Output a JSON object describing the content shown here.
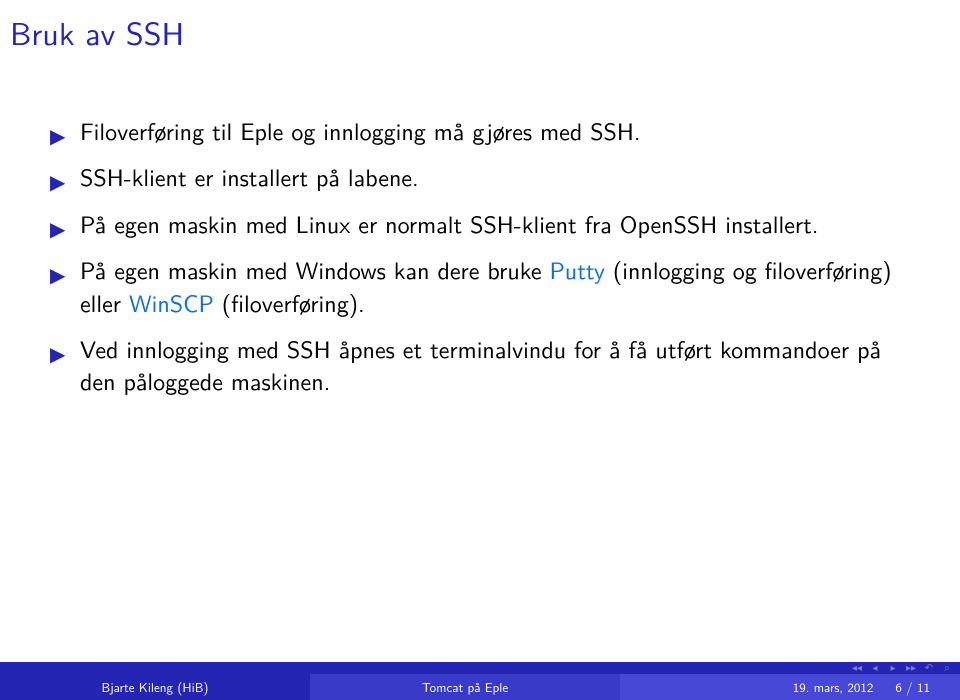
{
  "title": "Bruk av SSH",
  "bullets": [
    {
      "segments": [
        {
          "text": "Filoverføring til Eple og innlogging må gjøres med SSH."
        }
      ]
    },
    {
      "segments": [
        {
          "text": "SSH-klient er installert på labene."
        }
      ]
    },
    {
      "segments": [
        {
          "text": "På egen maskin med Linux er normalt SSH-klient fra OpenSSH installert."
        }
      ]
    },
    {
      "segments": [
        {
          "text": "På egen maskin med Windows kan dere bruke "
        },
        {
          "text": "Putty",
          "link": true
        },
        {
          "text": " (innlogging og filoverføring) eller "
        },
        {
          "text": "WinSCP",
          "link": true
        },
        {
          "text": " (filoverføring)."
        }
      ]
    },
    {
      "segments": [
        {
          "text": "Ved innlogging med SSH åpnes et terminalvindu for å få utført kommandoer på den påloggede maskinen."
        }
      ]
    }
  ],
  "footer": {
    "author": "Bjarte Kileng (HiB)",
    "talk_title": "Tomcat på Eple",
    "date": "19. mars, 2012",
    "page": "6 / 11"
  },
  "nav": {
    "first": "◂◂",
    "prev": "◂",
    "next": "▸",
    "last": "▸▸",
    "back": "↶",
    "search": "⌕"
  }
}
